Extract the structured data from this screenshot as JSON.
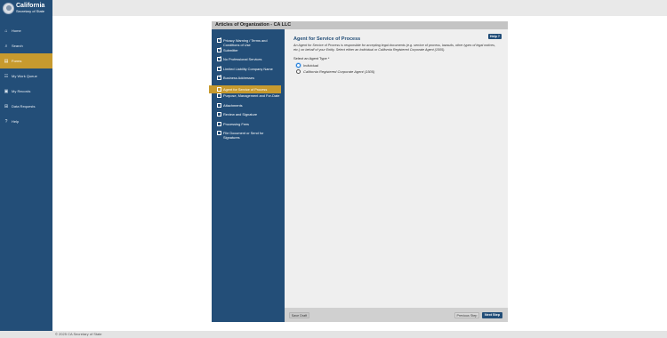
{
  "brand": {
    "title": "California",
    "subtitle": "Secretary of State"
  },
  "nav": [
    {
      "label": "Home",
      "icon": "home-icon",
      "glyph": "⌂"
    },
    {
      "label": "Search",
      "icon": "search-icon",
      "glyph": "⌕"
    },
    {
      "label": "Forms",
      "icon": "file-icon",
      "glyph": "▤",
      "active": true
    },
    {
      "label": "My Work Queue",
      "icon": "queue-icon",
      "glyph": "☷"
    },
    {
      "label": "My Records",
      "icon": "records-icon",
      "glyph": "▣"
    },
    {
      "label": "Data Requests",
      "icon": "data-icon",
      "glyph": "⊞"
    },
    {
      "label": "Help",
      "icon": "help-icon",
      "glyph": "?"
    }
  ],
  "form": {
    "title": "Articles of Organization - CA LLC",
    "help_label": "Help ?",
    "steps": [
      {
        "label": "Privacy Warning / Terms and Conditions of Use",
        "checked": true
      },
      {
        "label": "Submitter",
        "checked": true
      },
      {
        "label": "No Professional Services",
        "checked": true
      },
      {
        "label": "Limited Liability Company Name",
        "checked": true
      },
      {
        "label": "Business Addresses",
        "checked": true
      },
      {
        "label": "Agent for Service of Process",
        "checked": false,
        "active": true
      },
      {
        "label": "Purpose, Management and For-Date",
        "checked": false
      },
      {
        "label": "Attachments",
        "checked": false
      },
      {
        "label": "Review and Signature",
        "checked": false
      },
      {
        "label": "Processing Fees",
        "checked": false
      },
      {
        "label": "File Document or Send for Signatures",
        "checked": false
      }
    ],
    "section_title": "Agent for Service of Process",
    "description": "An Agent for Service of Process is responsible for accepting legal documents (e.g. service of process, lawsuits, other types of legal notices, etc.) on behalf of your Entity. Select either an Individual or California Registered Corporate Agent (1505).",
    "agent_type_label": "Select an Agent Type *",
    "agent_options": [
      {
        "label": "Individual",
        "focused": true
      },
      {
        "label": "California Registered Corporate Agent (1505)",
        "focused": false
      }
    ],
    "buttons": {
      "save_draft": "Save Draft",
      "previous": "Previous Step",
      "next": "Next Step"
    }
  },
  "footer": "© 2025 CA Secretary of State",
  "colors": {
    "navy": "#234e78",
    "gold": "#c79a2e"
  }
}
